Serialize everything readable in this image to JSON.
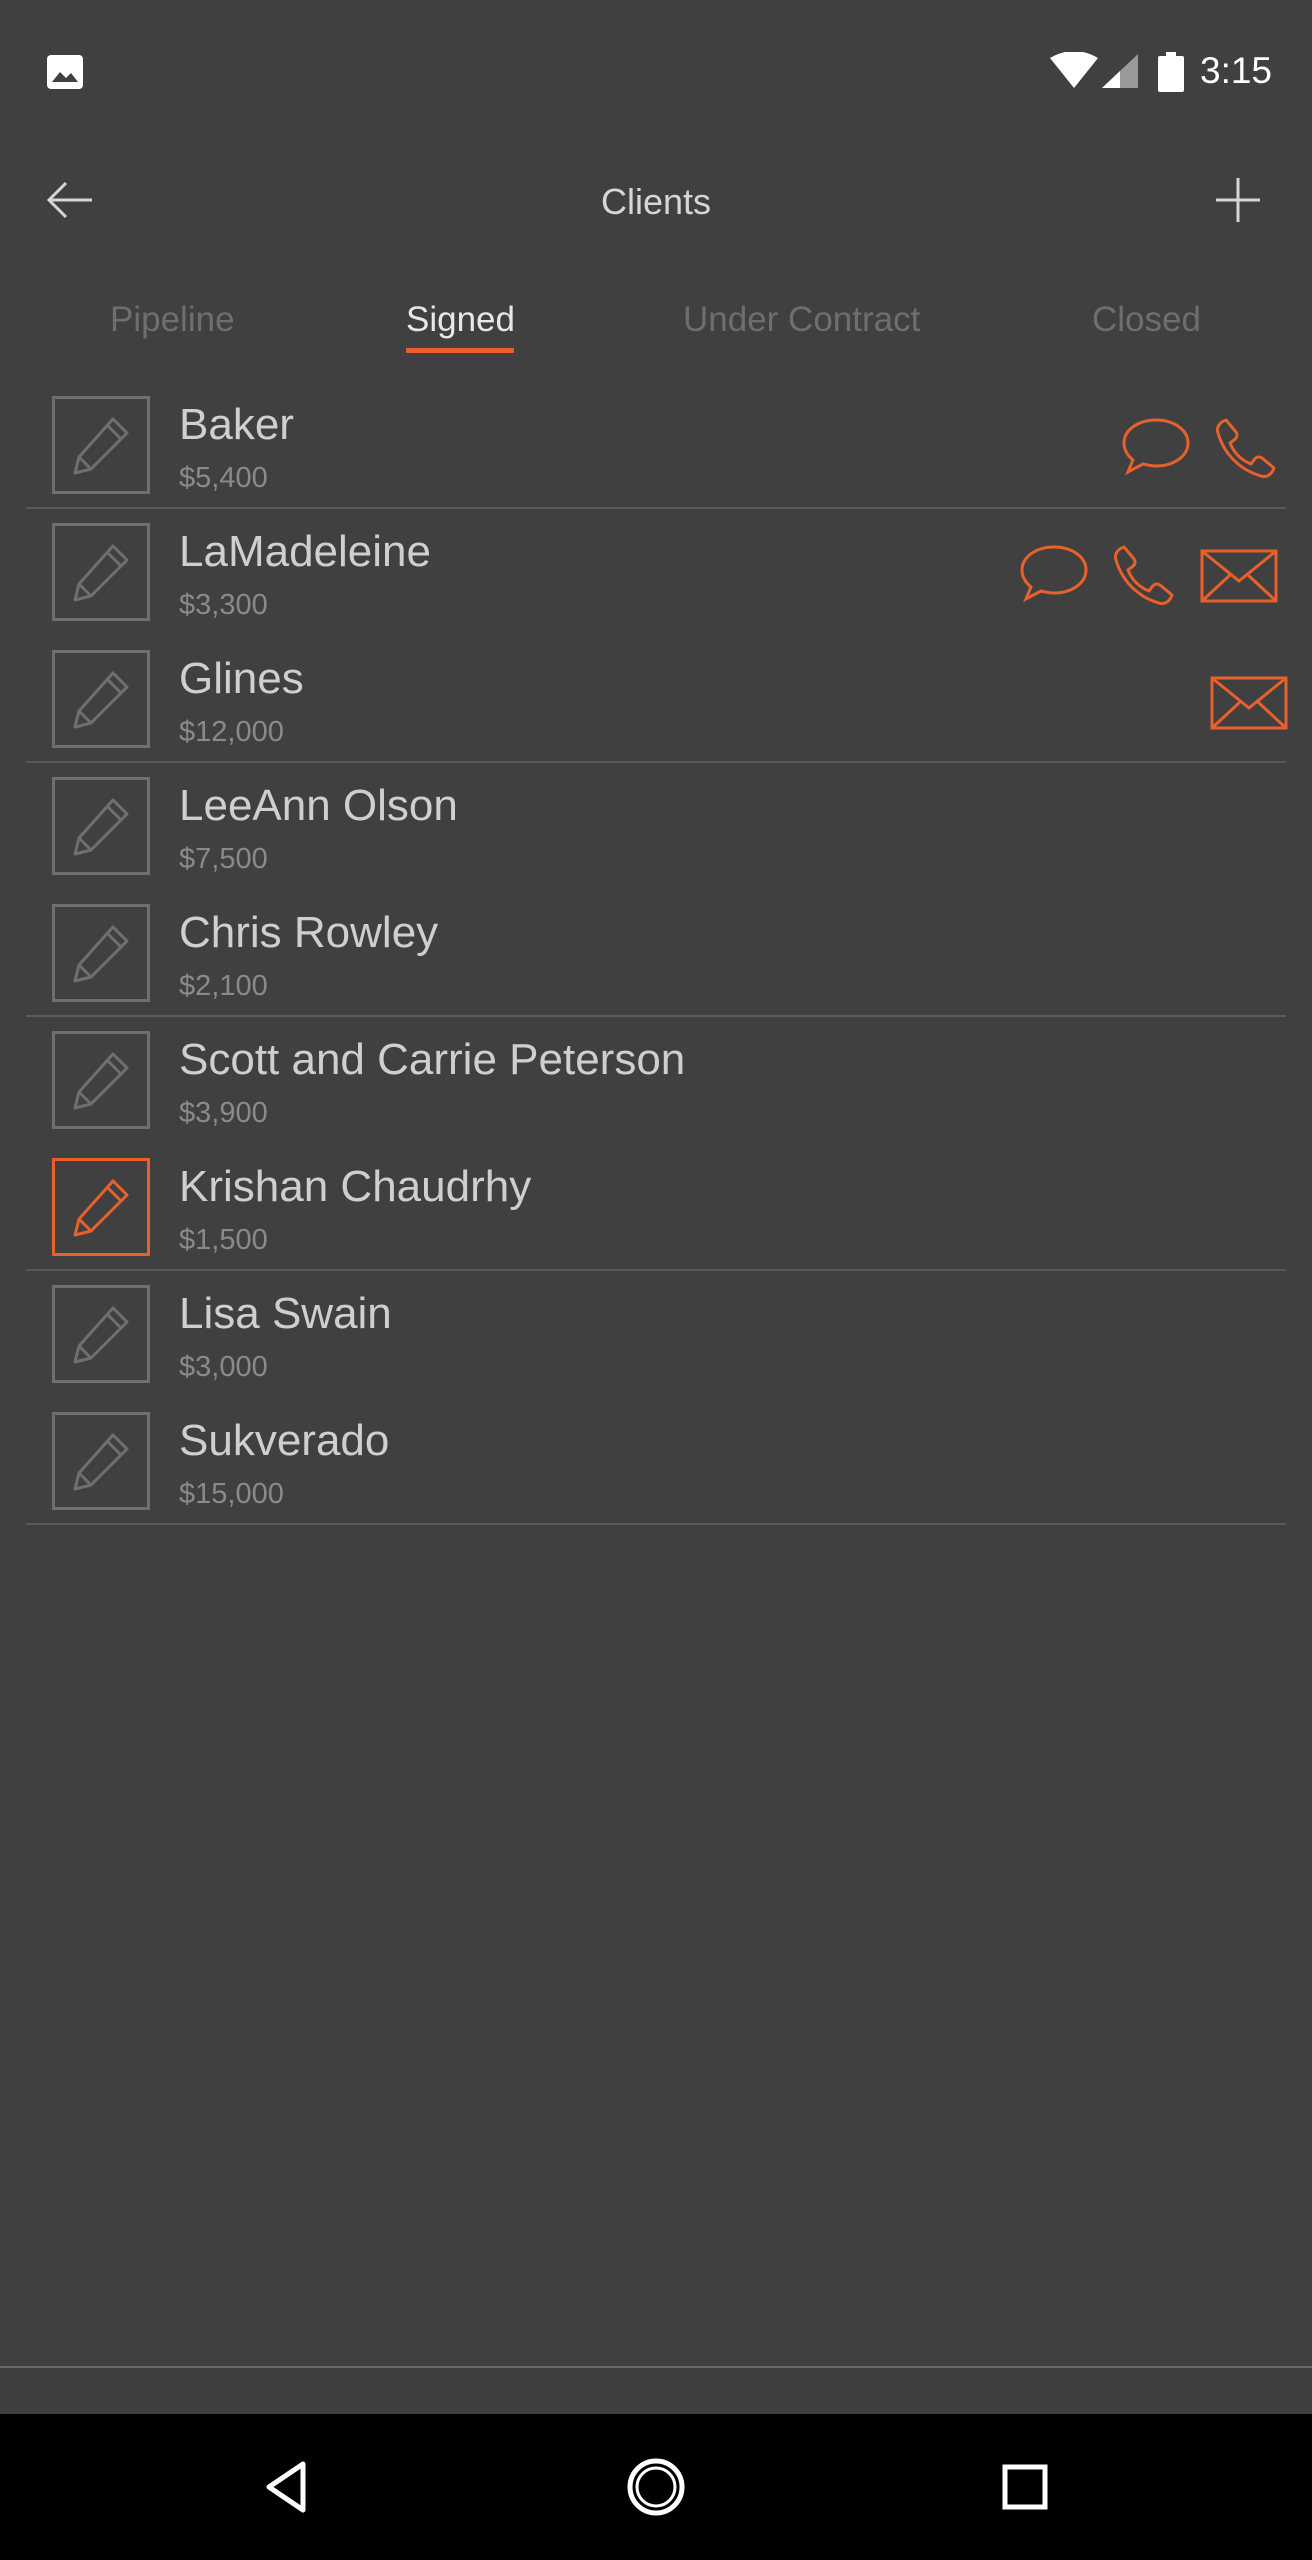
{
  "status_bar": {
    "time": "3:15"
  },
  "app_bar": {
    "title": "Clients"
  },
  "tabs": [
    {
      "label": "Pipeline"
    },
    {
      "label": "Signed"
    },
    {
      "label": "Under Contract"
    },
    {
      "label": "Closed"
    }
  ],
  "clients": [
    {
      "name": "Baker",
      "amount": "$5,400"
    },
    {
      "name": "LaMadeleine",
      "amount": "$3,300"
    },
    {
      "name": "Glines",
      "amount": "$12,000"
    },
    {
      "name": "LeeAnn Olson",
      "amount": "$7,500"
    },
    {
      "name": "Chris Rowley",
      "amount": "$2,100"
    },
    {
      "name": "Scott and Carrie Peterson",
      "amount": "$3,900"
    },
    {
      "name": "Krishan Chaudrhy",
      "amount": "$1,500"
    },
    {
      "name": "Lisa Swain",
      "amount": "$3,000"
    },
    {
      "name": "Sukverado",
      "amount": "$15,000"
    }
  ],
  "colors": {
    "accent": "#e8602c",
    "background": "#404040",
    "divider": "#5a5a5a"
  }
}
